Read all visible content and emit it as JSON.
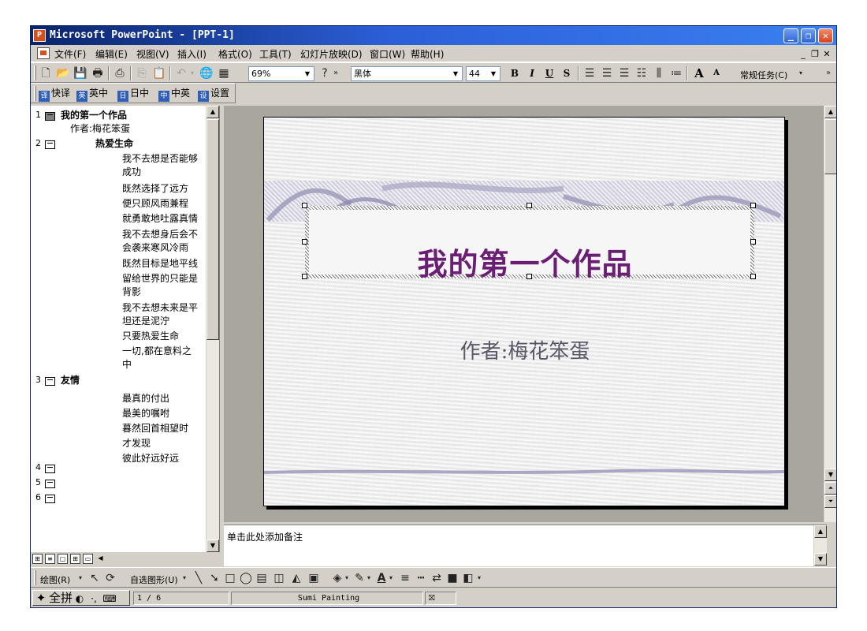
{
  "window": {
    "title": "Microsoft PowerPoint - [PPT-1]"
  },
  "menubar": {
    "items": [
      "文件(F)",
      "编辑(E)",
      "视图(V)",
      "插入(I)",
      "格式(O)",
      "工具(T)",
      "幻灯片放映(D)",
      "窗口(W)",
      "帮助(H)"
    ]
  },
  "toolbar": {
    "zoom": "69%",
    "font": "黑体",
    "font_size": "44",
    "task_pane": "常规任务(C)"
  },
  "translate_toolbar": {
    "items": [
      "快译",
      "英中",
      "日中",
      "中英",
      "设置"
    ],
    "icons": [
      "译",
      "英",
      "日",
      "中",
      "设"
    ]
  },
  "outline": {
    "slides": [
      {
        "num": "1",
        "title": "我的第一个作品",
        "lines": [
          "作者:梅花笨蛋"
        ]
      },
      {
        "num": "2",
        "title": "热爱生命",
        "lines": [
          "我不去想是否能够",
          "成功",
          "既然选择了远方",
          "便只顾风雨兼程",
          "就勇敢地吐露真情",
          "我不去想身后会不",
          "会袭来寒风冷雨",
          "既然目标是地平线",
          "留给世界的只能是",
          "背影",
          "我不去想未来是平",
          "坦还是泥泞",
          "只要热爱生命",
          "一切,都在意料之",
          "中"
        ]
      },
      {
        "num": "3",
        "title": "友情",
        "lines": [
          "最真的付出",
          "最美的嘱咐",
          "暮然回首相望时",
          "才发现",
          "彼此好远好远"
        ]
      },
      {
        "num": "4",
        "title": "",
        "lines": []
      },
      {
        "num": "5",
        "title": "",
        "lines": []
      },
      {
        "num": "6",
        "title": "",
        "lines": []
      }
    ]
  },
  "slide": {
    "title": "我的第一个作品",
    "subtitle": "作者:梅花笨蛋",
    "title_color": "#6a1f75"
  },
  "notes": {
    "placeholder": "单击此处添加备注"
  },
  "drawbar": {
    "draw_label": "绘图(R)",
    "autoshape_label": "自选图形(U)"
  },
  "statusbar": {
    "ime": "全拼",
    "slide_pos": "1 / 6",
    "design": "Sumi Painting"
  }
}
